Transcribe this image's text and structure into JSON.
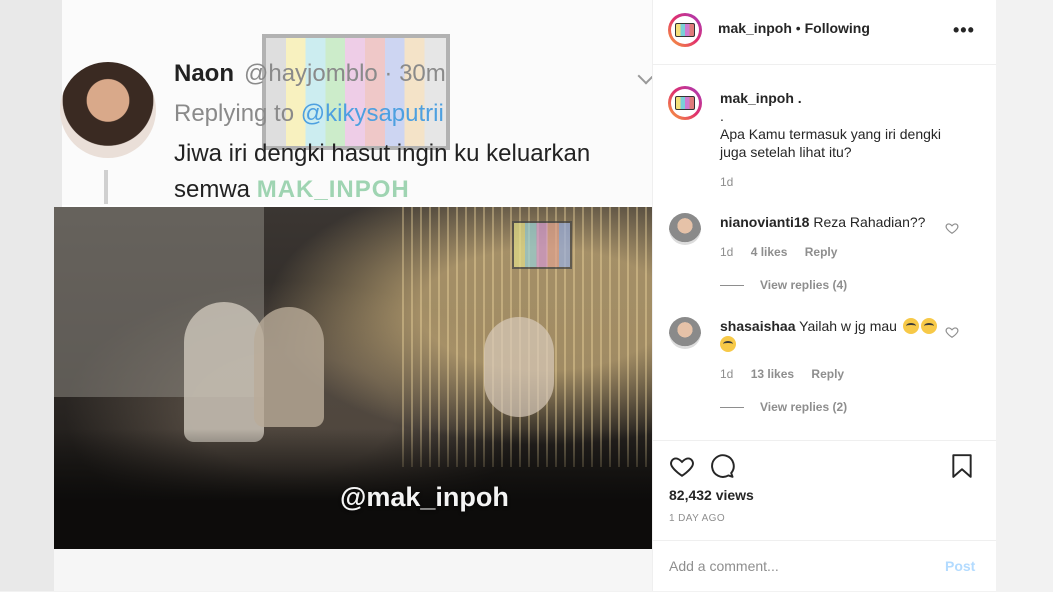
{
  "tweet": {
    "name": "Naon",
    "handle_time": "@hayjomblo · 30m",
    "replying_prefix": "Replying to",
    "replying_to": "@kikysaputrii",
    "text": "Jiwa iri dengki hasut ingin ku keluarkan semwa",
    "brand_text": "MAK_INPOH"
  },
  "video": {
    "watermark": "@mak_inpoh"
  },
  "header": {
    "username": "mak_inpoh",
    "separator": " • ",
    "follow_status": "Following",
    "more_icon": "more-horizontal-icon"
  },
  "caption": {
    "username": "mak_inpoh .",
    "dot_line": ".",
    "text": "Apa Kamu termasuk yang iri dengki juga setelah lihat itu?",
    "time": "1d"
  },
  "comments": [
    {
      "username": "nianovianti18",
      "text": "Reza Rahadian??",
      "time": "1d",
      "likes": "4 likes",
      "reply": "Reply",
      "view_replies": "View replies (4)"
    },
    {
      "username": "shasaishaa",
      "text": "Yailah w jg mau",
      "time": "1d",
      "likes": "13 likes",
      "reply": "Reply",
      "view_replies": "View replies (2)",
      "emoji": [
        "crying-face-icon",
        "crying-face-icon",
        "crying-face-icon"
      ]
    }
  ],
  "actions": {
    "views": "82,432 views",
    "ago": "1 DAY AGO"
  },
  "add_comment": {
    "placeholder": "Add a comment...",
    "post_label": "Post"
  },
  "colors": {
    "link": "#4da0e0",
    "post_disabled": "#b3dbff",
    "muted": "#8e8e8e"
  }
}
